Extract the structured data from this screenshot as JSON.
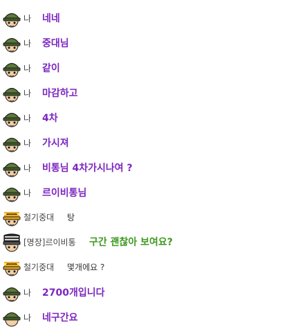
{
  "colors": {
    "me_text": "#7c26c0",
    "green_text": "#3c9a1e",
    "speaker_text": "#444444",
    "other_text": "#333333"
  },
  "messages": [
    {
      "speaker": "나",
      "text": "네네",
      "avatar": "soldier-helmet-icon",
      "style": "me"
    },
    {
      "speaker": "나",
      "text": "중대님",
      "avatar": "soldier-helmet-icon",
      "style": "me"
    },
    {
      "speaker": "나",
      "text": "같이",
      "avatar": "soldier-helmet-icon",
      "style": "me"
    },
    {
      "speaker": "나",
      "text": "마감하고",
      "avatar": "soldier-helmet-icon",
      "style": "me"
    },
    {
      "speaker": "나",
      "text": "4차",
      "avatar": "soldier-helmet-icon",
      "style": "me"
    },
    {
      "speaker": "나",
      "text": "가시져",
      "avatar": "soldier-helmet-icon",
      "style": "me"
    },
    {
      "speaker": "나",
      "text": "비통님 4차가시나여 ?",
      "avatar": "soldier-helmet-icon",
      "style": "me"
    },
    {
      "speaker": "나",
      "text": "르이비통님",
      "avatar": "soldier-helmet-icon",
      "style": "me"
    },
    {
      "speaker": "철기중대",
      "text": "탕",
      "avatar": "striped-helmet-icon",
      "style": "other"
    },
    {
      "speaker": "[명장]르이비통",
      "text": "구간 괜찮아 보여요?",
      "avatar": "dark-helmet-icon",
      "style": "green"
    },
    {
      "speaker": "철기중대",
      "text": "몇개에요 ?",
      "avatar": "striped-helmet-icon",
      "style": "other"
    },
    {
      "speaker": "나",
      "text": "2700개입니다",
      "avatar": "soldier-helmet-icon",
      "style": "me"
    },
    {
      "speaker": "나",
      "text": "네구간요",
      "avatar": "soldier-helmet-icon",
      "style": "me"
    }
  ]
}
